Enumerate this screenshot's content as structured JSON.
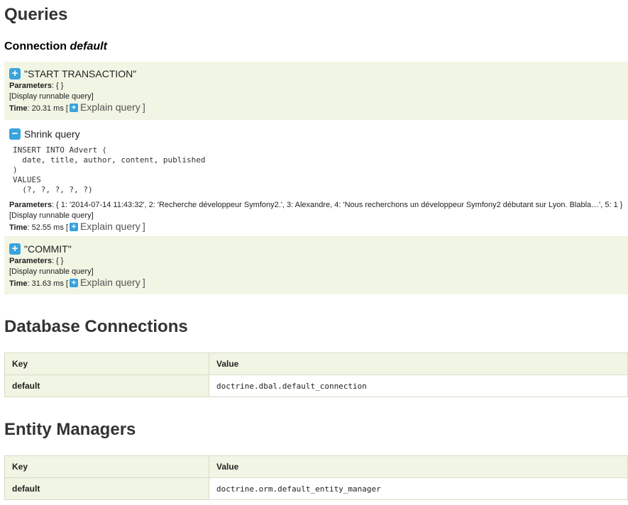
{
  "page_title": "Queries",
  "connection": {
    "label": "Connection",
    "name": "default"
  },
  "queries": [
    {
      "title": "\"START TRANSACTION\"",
      "params_label": "Parameters",
      "params_value": ": { }",
      "runnable": "[Display runnable query]",
      "time_label": "Time",
      "time_value": ": 20.31 ms [",
      "explain": "Explain query",
      "close_bracket": "]"
    },
    {
      "title": "Shrink query",
      "sql_lines": [
        "INSERT INTO Advert (",
        "  date, title, author, content, published",
        ")",
        "VALUES",
        "  (?, ?, ?, ?, ?)"
      ],
      "params_label": "Parameters",
      "params_value": ": { 1: '2014-07-14 11:43:32', 2: 'Recherche développeur Symfony2.', 3: Alexandre, 4: 'Nous recherchons un développeur Symfony2 débutant sur Lyon. Blabla…', 5: 1 }",
      "runnable": "[Display runnable query]",
      "time_label": "Time",
      "time_value": ": 52.55 ms [",
      "explain": "Explain query",
      "close_bracket": "]"
    },
    {
      "title": "\"COMMIT\"",
      "params_label": "Parameters",
      "params_value": ": { }",
      "runnable": "[Display runnable query]",
      "time_label": "Time",
      "time_value": ": 31.63 ms [",
      "explain": "Explain query",
      "close_bracket": "]"
    }
  ],
  "db_connections": {
    "title": "Database Connections",
    "headers": [
      "Key",
      "Value"
    ],
    "rows": [
      [
        "default",
        "doctrine.dbal.default_connection"
      ]
    ]
  },
  "entity_managers": {
    "title": "Entity Managers",
    "headers": [
      "Key",
      "Value"
    ],
    "rows": [
      [
        "default",
        "doctrine.orm.default_entity_manager"
      ]
    ]
  },
  "colors": {
    "accent": "#3aa3dc",
    "row_bg": "#f1f5e3",
    "border": "#d8dcc8"
  },
  "icons": {
    "expand": "plus-icon",
    "collapse": "minus-icon"
  }
}
